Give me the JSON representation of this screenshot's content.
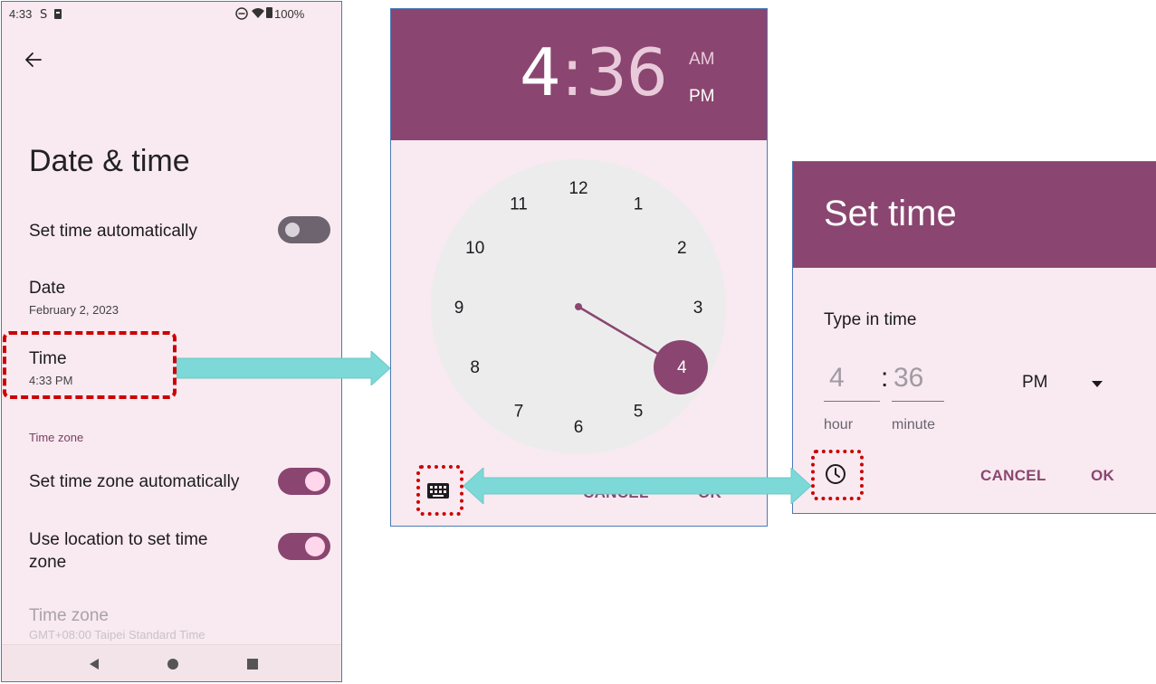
{
  "settings": {
    "status_time": "4:33",
    "battery": "100%",
    "title": "Date & time",
    "set_time_auto": "Set time automatically",
    "date_label": "Date",
    "date_value": "February 2, 2023",
    "time_label": "Time",
    "time_value": "4:33 PM",
    "section_time_zone": "Time zone",
    "set_zone_auto": "Set time zone automatically",
    "use_location": "Use location to set time zone",
    "time_zone_label": "Time zone",
    "time_zone_value": "GMT+08:00 Taipei Standard Time",
    "toggles": {
      "set_time_auto": false,
      "set_zone_auto": true,
      "use_location": true
    }
  },
  "clock_picker": {
    "time_hour": "4",
    "time_sep": ":",
    "time_minute": "36",
    "am": "AM",
    "pm": "PM",
    "selected_period": "PM",
    "selected_hour": 4,
    "hours": [
      "12",
      "1",
      "2",
      "3",
      "4",
      "5",
      "6",
      "7",
      "8",
      "9",
      "10",
      "11"
    ],
    "cancel": "CANCEL",
    "ok": "OK"
  },
  "set_time": {
    "title": "Set time",
    "subtitle": "Type in time",
    "hour_value": "4",
    "separator": ":",
    "minute_value": "36",
    "hour_label": "hour",
    "minute_label": "minute",
    "period": "PM",
    "cancel": "CANCEL",
    "ok": "OK"
  },
  "colors": {
    "accent": "#8a4670",
    "surface": "#f8eaf0",
    "arrow": "#7dd8d8",
    "annotation": "#cc0000"
  }
}
